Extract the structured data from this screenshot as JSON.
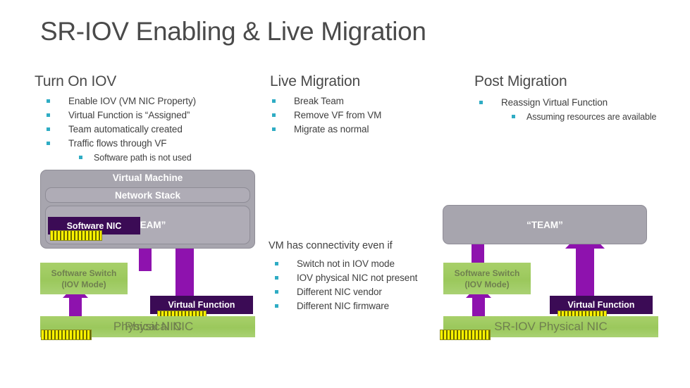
{
  "slide": {
    "title": "SR-IOV Enabling & Live Migration"
  },
  "columns": [
    {
      "heading": "Turn On IOV",
      "bullets": [
        {
          "level": 1,
          "text": "Enable IOV (VM NIC Property)"
        },
        {
          "level": 1,
          "text": "Virtual Function is “Assigned”"
        },
        {
          "level": 1,
          "text": "Team automatically created"
        },
        {
          "level": 1,
          "text": "Traffic flows through VF"
        },
        {
          "level": 2,
          "text": "Software path is not used"
        }
      ]
    },
    {
      "heading": "Live Migration",
      "bullets": [
        {
          "level": 1,
          "text": "Break Team"
        },
        {
          "level": 1,
          "text": "Remove VF from VM"
        },
        {
          "level": 1,
          "text": "Migrate as normal"
        }
      ]
    },
    {
      "heading": "Post Migration",
      "bullets": [
        {
          "level": 1,
          "text": "Reassign Virtual Function"
        },
        {
          "level": 2,
          "text": "Assuming resources are available"
        }
      ]
    }
  ],
  "middle_note": {
    "lead": "VM has connectivity even if",
    "bullets": [
      {
        "level": 1,
        "text": "Switch not in IOV mode"
      },
      {
        "level": 1,
        "text": "IOV physical NIC not present"
      },
      {
        "level": 1,
        "text": "Different NIC vendor"
      },
      {
        "level": 1,
        "text": "Different NIC firmware"
      }
    ]
  },
  "left_diagram": {
    "vm_label": "Virtual Machine",
    "network_stack_label": "Network Stack",
    "team_label": "“TEAM”",
    "software_nic_label": "Software NIC",
    "software_switch_line1": "Software Switch",
    "software_switch_line2": "(IOV Mode)",
    "virtual_function_label": "Virtual Function",
    "physical_nic_label": "Physical NIC",
    "physical_nic_label_overlap": "Physical NIC"
  },
  "right_diagram": {
    "team_label": "“TEAM”",
    "software_switch_line1": "Software Switch",
    "software_switch_line2": "(IOV Mode)",
    "virtual_function_label": "Virtual Function",
    "physical_nic_label": "SR-IOV Physical NIC"
  },
  "colors": {
    "bullet": "#2FACC4",
    "green": "#9BC85C",
    "purple_box": "#3B0B55",
    "purple_arrow": "#8E12AE",
    "gray_box": "#A7A5AE",
    "port_yellow": "#FFF200",
    "title_text": "#4a4a4a"
  }
}
